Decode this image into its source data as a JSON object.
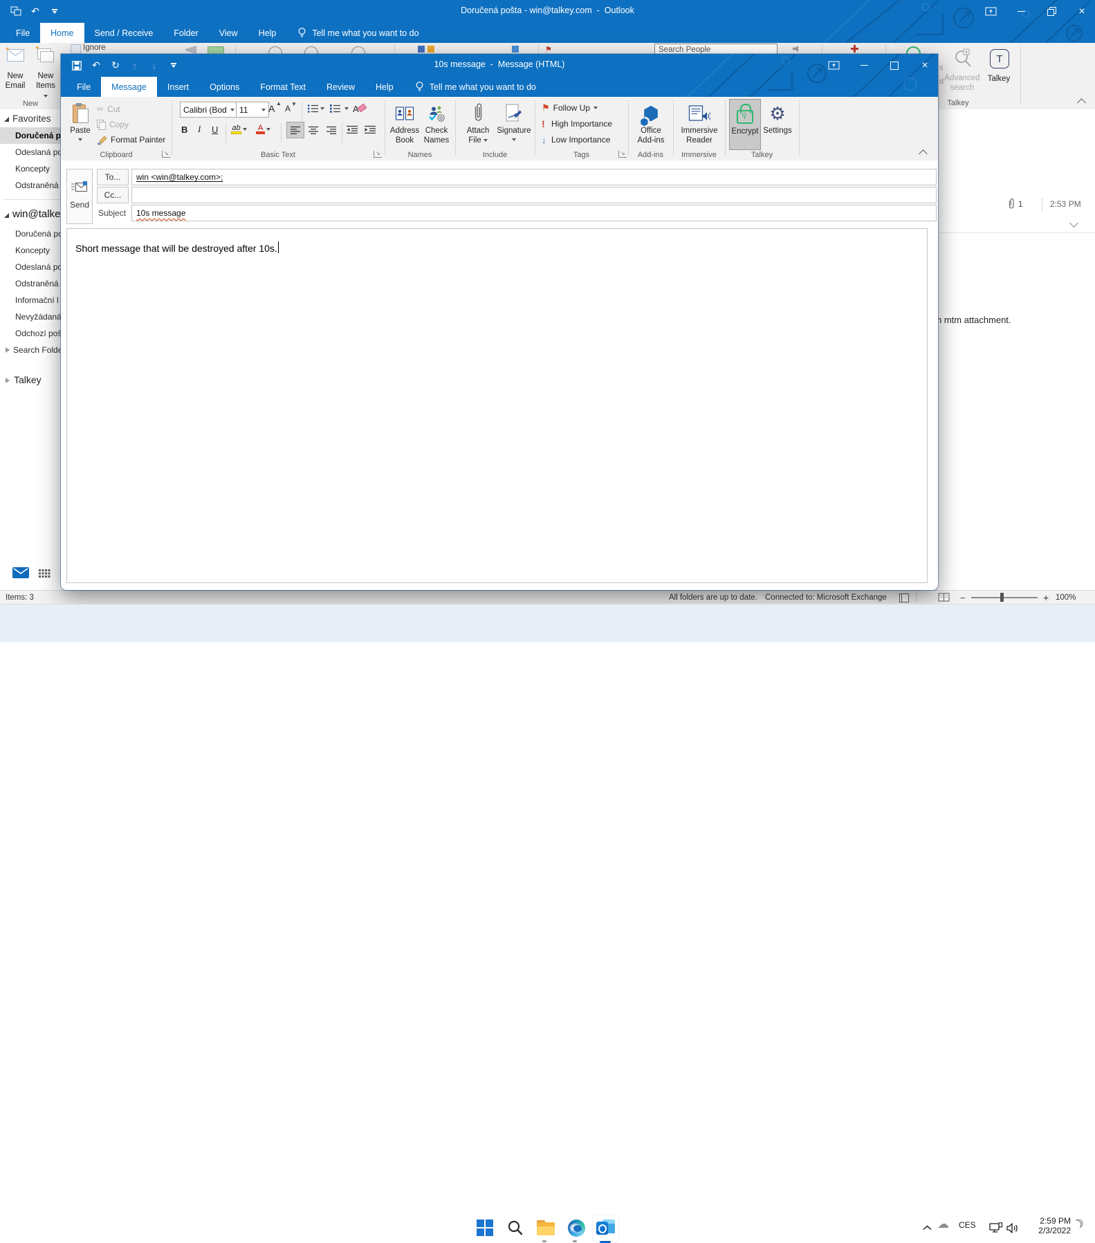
{
  "main": {
    "title": "Doručená pošta - win@talkey.com  -  Outlook",
    "tabs": [
      "File",
      "Home",
      "Send / Receive",
      "Folder",
      "View",
      "Help"
    ],
    "tellme": "Tell me what you want to do",
    "newgrp": {
      "email1": "New",
      "email2": "Email",
      "items1": "New",
      "items2": "Items",
      "label": "New"
    },
    "remnant": {
      "ignore": "Ignore",
      "search_people": "Search People"
    },
    "sidebar": {
      "fav_header": "Favorites",
      "fav": [
        "Doručená p",
        "Odeslaná po",
        "Koncepty",
        "Odstraněná"
      ],
      "acct_header": "win@talke",
      "acct": [
        "Doručená po",
        "Koncepty",
        "Odeslaná po",
        "Odstraněná",
        "Informační l",
        "Nevyžádaná",
        "Odchozí poš",
        "Search Folde"
      ],
      "talkey": "Talkey"
    },
    "right": {
      "partial1": "s",
      "partial2": "d",
      "adv1": "Advanced",
      "adv2": "search",
      "talkey_icon_letter": "T",
      "talkey_btn": "Talkey",
      "talkey_grp": "Talkey",
      "attach": "1",
      "time": "2:53 PM",
      "snippet": "n mtm attachment."
    },
    "status": {
      "items": "Items: 3",
      "folders": "All folders are up to date.",
      "connected": "Connected to: Microsoft Exchange",
      "zoom": "100%"
    }
  },
  "compose": {
    "title": "10s message  -  Message (HTML)",
    "tabs": [
      "File",
      "Message",
      "Insert",
      "Options",
      "Format Text",
      "Review",
      "Help"
    ],
    "tellme": "Tell me what you want to do",
    "clip": {
      "paste": "Paste",
      "cut": "Cut",
      "copy": "Copy",
      "fp": "Format Painter",
      "label": "Clipboard"
    },
    "basic": {
      "font": "Calibri (Bod",
      "size": "11",
      "a": "A",
      "b": "B",
      "i": "I",
      "u": "U",
      "hl": "ab",
      "fc": "A",
      "label": "Basic Text"
    },
    "names": {
      "ab1": "Address",
      "ab2": "Book",
      "cn1": "Check",
      "cn2": "Names",
      "label": "Names"
    },
    "include": {
      "af1": "Attach",
      "af2": "File",
      "sig": "Signature",
      "label": "Include"
    },
    "tags": {
      "fu": "Follow Up",
      "hi": "High Importance",
      "lo": "Low Importance",
      "label": "Tags"
    },
    "addins": {
      "l1": "Office",
      "l2": "Add-ins",
      "label": "Add-ins"
    },
    "imm": {
      "l1": "Immersive",
      "l2": "Reader",
      "label": "Immersive"
    },
    "talkey": {
      "enc": "Encrypt",
      "set": "Settings",
      "label": "Talkey"
    },
    "env": {
      "send": "Send",
      "to": "To...",
      "to_value": "win <win@talkey.com>;",
      "cc": "Cc...",
      "subject": "Subject",
      "subject_value": "10s message"
    },
    "body": "Short message that will be destroyed after 10s."
  },
  "taskbar": {
    "lang": "CES",
    "time": "2:59 PM",
    "date": "2/3/2022"
  }
}
